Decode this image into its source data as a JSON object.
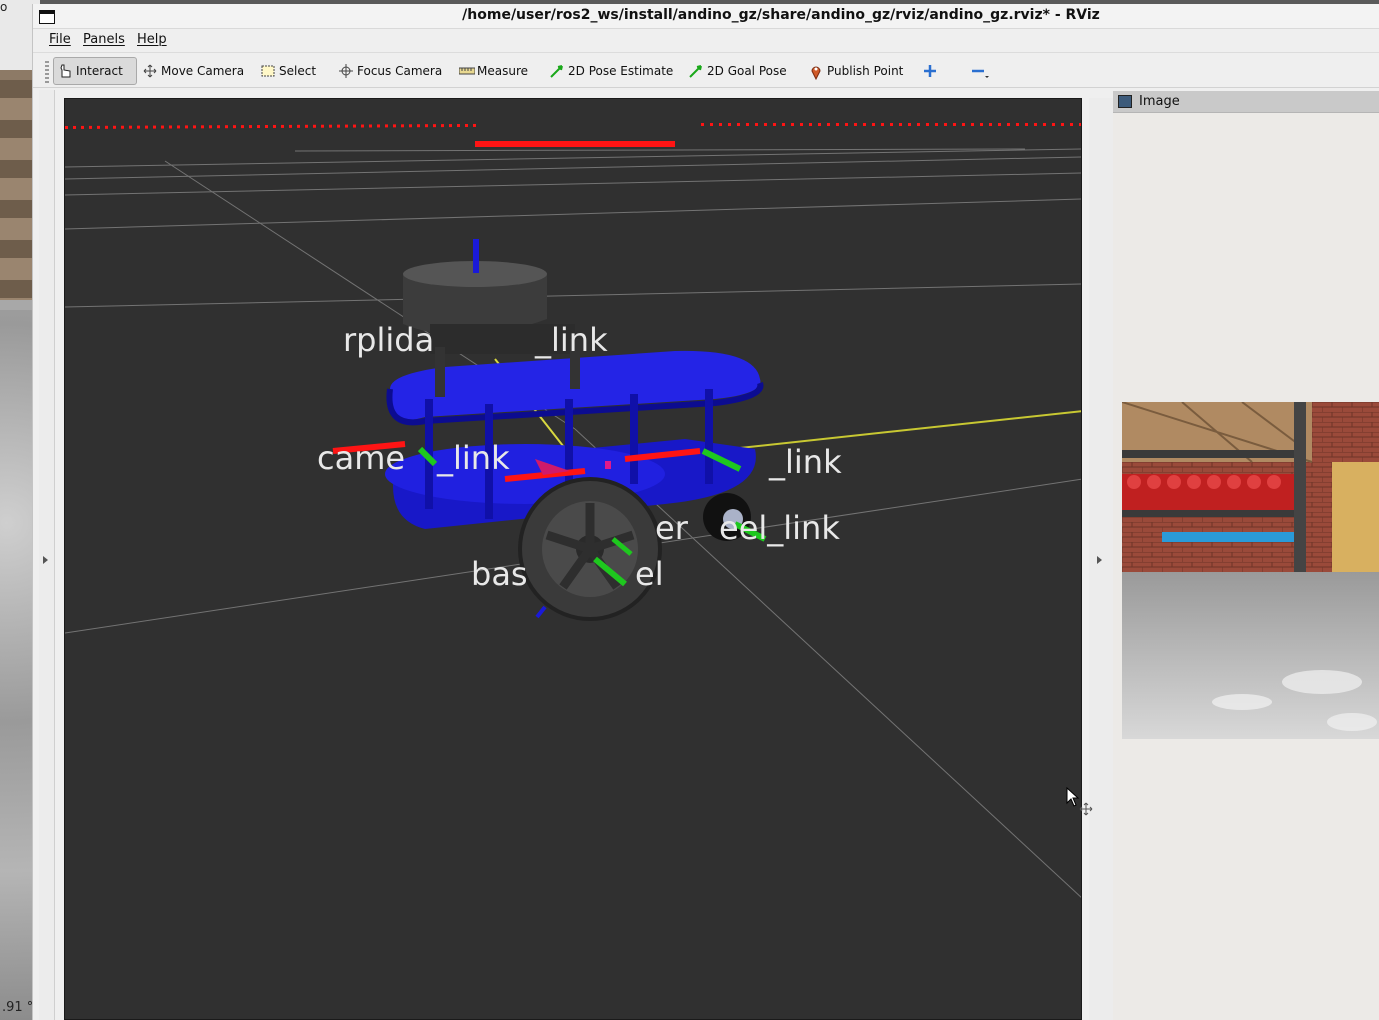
{
  "background": {
    "readout": ".91 °",
    "top_glyph": "o"
  },
  "window": {
    "title": "/home/user/ros2_ws/install/andino_gz/share/andino_gz/rviz/andino_gz.rviz* - RViz"
  },
  "menu": {
    "file": "File",
    "panels": "Panels",
    "help": "Help"
  },
  "toolbar": {
    "interact": "Interact",
    "move_camera": "Move Camera",
    "select": "Select",
    "focus_camera": "Focus Camera",
    "measure": "Measure",
    "pose_estimate": "2D Pose Estimate",
    "goal_pose": "2D Goal Pose",
    "publish_point": "Publish Point"
  },
  "scene": {
    "labels": {
      "rplidar": "rplida",
      "rplidar_tail": "_link",
      "camera": "came",
      "camera_tail": "_link",
      "right_link": "_link",
      "wheel_a": "er",
      "wheel_b": "eel_link",
      "base_a": "bas",
      "base_b": "el"
    }
  },
  "image_panel": {
    "title": "Image"
  },
  "colors": {
    "render_bg": "#303030",
    "robot_blue": "#1a1ad8",
    "laser_red": "#ff1414",
    "axis_green": "#1ec81e"
  }
}
